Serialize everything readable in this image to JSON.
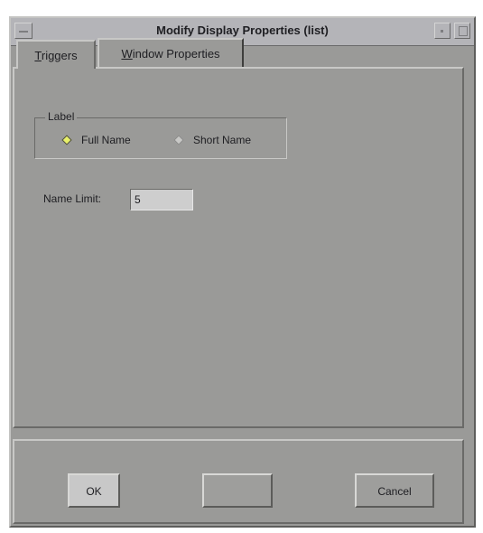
{
  "window": {
    "title": "Modify Display Properties (list)"
  },
  "tabs": [
    {
      "label": "Triggers",
      "mnemonic": "T",
      "rest": "riggers",
      "selected": true
    },
    {
      "label": "Window Properties",
      "mnemonic": "W",
      "rest": "indow Properties",
      "selected": false
    }
  ],
  "label_group": {
    "title": "Label",
    "options": [
      {
        "label": "Full Name",
        "selected": true
      },
      {
        "label": "Short Name",
        "selected": false
      }
    ]
  },
  "name_limit": {
    "label": "Name Limit:",
    "value": "5"
  },
  "buttons": {
    "ok": "OK",
    "apply": "",
    "cancel": "Cancel"
  },
  "colors": {
    "background": "#9a9a98",
    "titlebar": "#b4b4b8",
    "radio_selected": "#e8f06a"
  }
}
